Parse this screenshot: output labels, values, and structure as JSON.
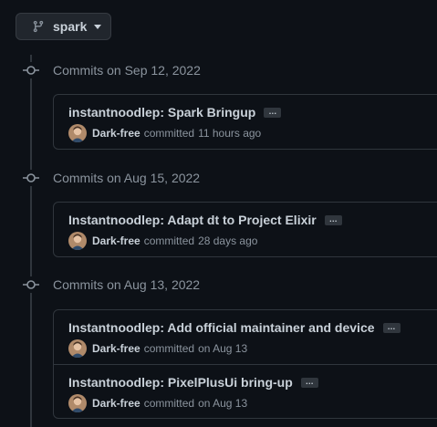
{
  "branch": {
    "name": "spark",
    "icon": "git-branch-icon",
    "caret_icon": "triangle-down-icon"
  },
  "colors": {
    "background": "#0d1117",
    "border": "#30363d",
    "text_primary": "#c9d1d9",
    "text_muted": "#8b949e"
  },
  "days": [
    {
      "header": "Commits on Sep 12, 2022",
      "commits": [
        {
          "title": "instantnoodlep: Spark Bringup",
          "ellipsis": "…",
          "author": "Dark-free",
          "verb": "committed",
          "time": "11 hours ago"
        }
      ]
    },
    {
      "header": "Commits on Aug 15, 2022",
      "commits": [
        {
          "title": "Instantnoodlep: Adapt dt to Project Elixir",
          "ellipsis": "…",
          "author": "Dark-free",
          "verb": "committed",
          "time": "28 days ago"
        }
      ]
    },
    {
      "header": "Commits on Aug 13, 2022",
      "commits": [
        {
          "title": "Instantnoodlep: Add official maintainer and device",
          "ellipsis": "…",
          "author": "Dark-free",
          "verb": "committed",
          "time": "on Aug 13"
        },
        {
          "title": "Instantnoodlep: PixelPlusUi bring-up",
          "ellipsis": "…",
          "author": "Dark-free",
          "verb": "committed",
          "time": "on Aug 13"
        }
      ]
    }
  ]
}
